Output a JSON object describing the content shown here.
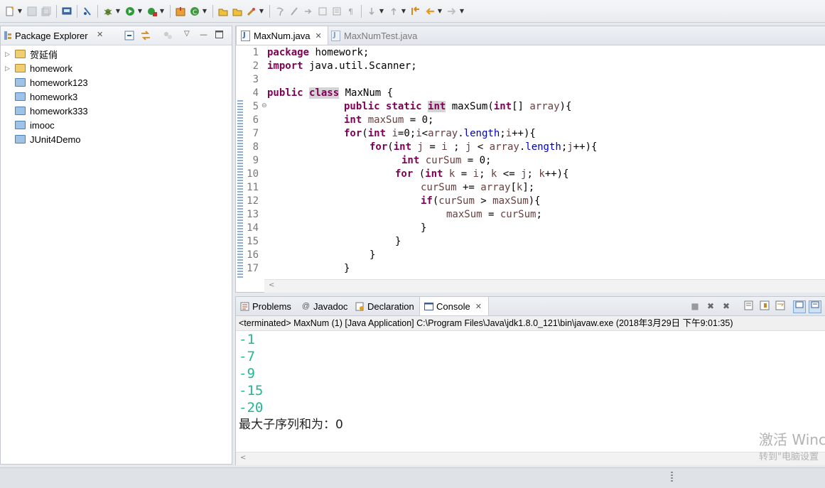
{
  "toolbar": {
    "icons": [
      "new-icon",
      "save-icon",
      "save-all-icon",
      "print-icon",
      "toggle-breakpoint-icon",
      "debug-icon",
      "run-icon",
      "external-tools-icon",
      "new-java-project-icon",
      "new-class-icon",
      "open-type-icon",
      "open-task-icon",
      "search-icon",
      "pin-icon",
      "annotation-icon",
      "next-annotation-icon",
      "prev-annotation-icon",
      "back-icon",
      "forward-icon"
    ]
  },
  "package_explorer": {
    "title": "Package Explorer",
    "projects": [
      {
        "name": "贺延俏",
        "expandable": true
      },
      {
        "name": "homework",
        "expandable": true
      },
      {
        "name": "homework123",
        "expandable": false
      },
      {
        "name": "homework3",
        "expandable": false
      },
      {
        "name": "homework333",
        "expandable": false
      },
      {
        "name": "imooc",
        "expandable": false
      },
      {
        "name": "JUnit4Demo",
        "expandable": false
      }
    ]
  },
  "editor": {
    "tabs": [
      {
        "label": "MaxNum.java",
        "active": true
      },
      {
        "label": "MaxNumTest.java",
        "active": false
      }
    ],
    "line_numbers": [
      "1",
      "2",
      "3",
      "4",
      "5",
      "6",
      "7",
      "8",
      "9",
      "10",
      "11",
      "12",
      "13",
      "14",
      "15",
      "16",
      "17"
    ],
    "code": {
      "l1_kw": "package",
      "l1_rest": " homework;",
      "l2_kw": "import",
      "l2_rest": " java.util.Scanner;",
      "l4_kw1": "public",
      "l4_kw2": "class",
      "l4_rest": " MaxNum {",
      "l5_kw1": "public",
      "l5_kw2": "static",
      "l5_kw3": "int",
      "l5_mid": " maxSum(",
      "l5_kw4": "int",
      "l5_mid2": "[] ",
      "l5_id": "array",
      "l5_end": "){",
      "l6_kw": "int",
      "l6_id": "maxSum",
      "l6_rest": " = 0;",
      "l7_kw1": "for",
      "l7_p": "(",
      "l7_kw2": "int",
      "l7_a": " ",
      "l7_i": "i",
      "l7_b": "=0;",
      "l7_i2": "i",
      "l7_c": "<",
      "l7_arr": "array",
      "l7_dot": ".",
      "l7_len": "length",
      "l7_d": ";",
      "l7_i3": "i",
      "l7_e": "++){",
      "l8_kw1": "for",
      "l8_p": "(",
      "l8_kw2": "int",
      "l8_a": " ",
      "l8_j": "j",
      "l8_b": " = ",
      "l8_i": "i",
      "l8_c": " ; ",
      "l8_j2": "j",
      "l8_d": " < ",
      "l8_arr": "array",
      "l8_dot": ".",
      "l8_len": "length",
      "l8_e": ";",
      "l8_j3": "j",
      "l8_f": "++){",
      "l9_kw": "int",
      "l9_id": "curSum",
      "l9_rest": " = 0;",
      "l10_kw1": "for",
      "l10_p": " (",
      "l10_kw2": "int",
      "l10_a": " ",
      "l10_k": "k",
      "l10_b": " = ",
      "l10_i": "i",
      "l10_c": "; ",
      "l10_k2": "k",
      "l10_d": " <= ",
      "l10_j": "j",
      "l10_e": "; ",
      "l10_k3": "k",
      "l10_f": "++){",
      "l11_id": "curSum",
      "l11_a": " += ",
      "l11_arr": "array",
      "l11_b": "[",
      "l11_k": "k",
      "l11_c": "];",
      "l12_kw": "if",
      "l12_a": "(",
      "l12_cur": "curSum",
      "l12_b": " > ",
      "l12_max": "maxSum",
      "l12_c": "){",
      "l13_max": "maxSum",
      "l13_a": " = ",
      "l13_cur": "curSum",
      "l13_b": ";",
      "l14": "}",
      "l15": "}",
      "l16": "}",
      "l17": "}"
    }
  },
  "views": {
    "tabs": [
      {
        "label": "Problems",
        "active": false
      },
      {
        "label": "Javadoc",
        "active": false
      },
      {
        "label": "Declaration",
        "active": false
      },
      {
        "label": "Console",
        "active": true
      }
    ],
    "console_description": "<terminated> MaxNum (1) [Java Application] C:\\Program Files\\Java\\jdk1.8.0_121\\bin\\javaw.exe (2018年3月29日 下午9:01:35)",
    "output": [
      "-1",
      "-7",
      "-9",
      "-15",
      "-20"
    ],
    "result_line": "最大子序列和为：0"
  },
  "watermark": {
    "line1": "激活 Winc",
    "line2": "转到\"电脑设置"
  },
  "colors": {
    "keyword": "#7f0055",
    "field": "#0000c0",
    "local_var": "#6a3e3e",
    "console_number": "#1fb894"
  }
}
